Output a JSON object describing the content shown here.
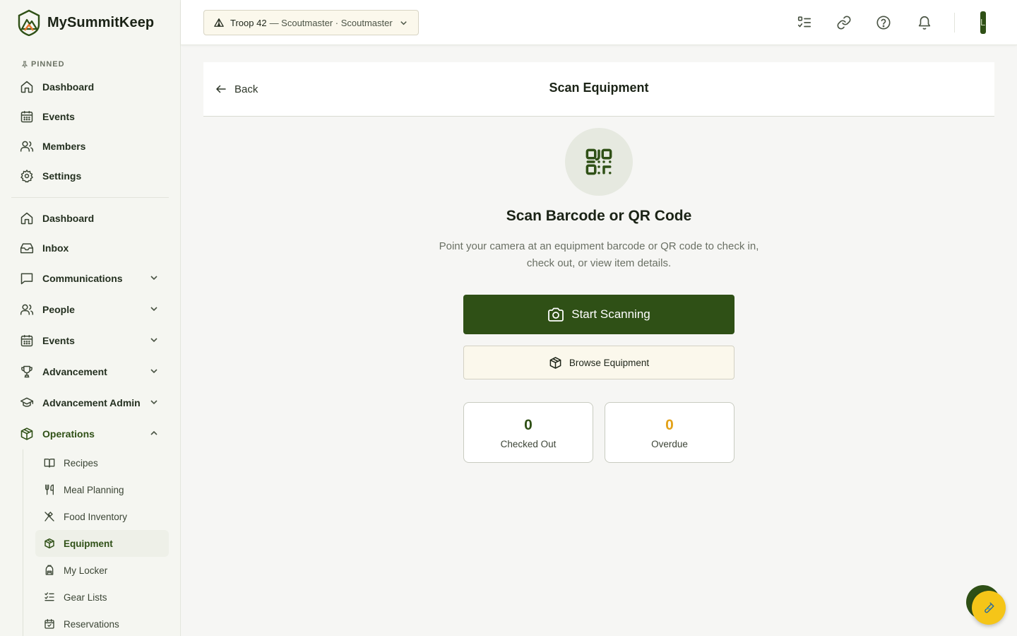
{
  "brand": {
    "name": "MySummitKeep"
  },
  "sidebar": {
    "pinned_label": "PINNED",
    "pinned": [
      {
        "label": "Dashboard",
        "icon": "home-icon"
      },
      {
        "label": "Events",
        "icon": "calendar-icon"
      },
      {
        "label": "Members",
        "icon": "users-icon"
      },
      {
        "label": "Settings",
        "icon": "gear-icon"
      }
    ],
    "main": [
      {
        "label": "Dashboard",
        "icon": "home-icon"
      },
      {
        "label": "Inbox",
        "icon": "inbox-icon"
      },
      {
        "label": "Communications",
        "icon": "message-icon"
      },
      {
        "label": "People",
        "icon": "users-icon"
      },
      {
        "label": "Events",
        "icon": "calendar-icon"
      },
      {
        "label": "Advancement",
        "icon": "trophy-icon"
      },
      {
        "label": "Advancement Admin",
        "icon": "graduation-cap-icon"
      },
      {
        "label": "Operations",
        "icon": "package-icon"
      }
    ],
    "operations_sub": [
      {
        "label": "Recipes",
        "icon": "book-icon"
      },
      {
        "label": "Meal Planning",
        "icon": "utensils-icon"
      },
      {
        "label": "Food Inventory",
        "icon": "utensils-crossed-icon"
      },
      {
        "label": "Equipment",
        "icon": "package-icon"
      },
      {
        "label": "My Locker",
        "icon": "backpack-icon"
      },
      {
        "label": "Gear Lists",
        "icon": "list-checks-icon"
      },
      {
        "label": "Reservations",
        "icon": "calendar-check-icon"
      }
    ]
  },
  "topbar": {
    "troop_name": "Troop 42",
    "troop_role": "— Scoutmaster · Scoutmaster",
    "avatar_initial": "L"
  },
  "page": {
    "back_label": "Back",
    "title": "Scan Equipment",
    "heading": "Scan Barcode or QR Code",
    "description": "Point your camera at an equipment barcode or QR code to check in, check out, or view item details.",
    "start_scanning_label": "Start Scanning",
    "browse_label": "Browse Equipment"
  },
  "stats": {
    "checked_out": {
      "value": "0",
      "label": "Checked Out"
    },
    "overdue": {
      "value": "0",
      "label": "Overdue"
    }
  },
  "colors": {
    "primary": "#2f5016",
    "overdue": "#e3a21a",
    "secondary_bg": "#fbf8ec"
  }
}
